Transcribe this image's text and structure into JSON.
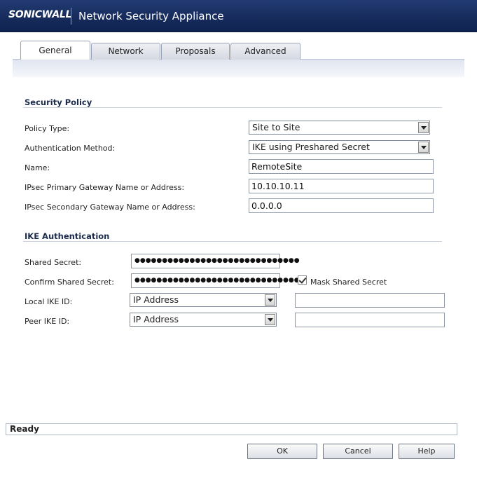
{
  "header": {
    "logo_text": "SONICWALL",
    "title": "Network Security Appliance"
  },
  "tabs": [
    {
      "label": "General",
      "active": true
    },
    {
      "label": "Network",
      "active": false
    },
    {
      "label": "Proposals",
      "active": false
    },
    {
      "label": "Advanced",
      "active": false
    }
  ],
  "security_policy": {
    "section_title": "Security Policy",
    "policy_type_label": "Policy Type:",
    "policy_type_value": "Site to Site",
    "auth_method_label": "Authentication Method:",
    "auth_method_value": "IKE using Preshared Secret",
    "name_label": "Name:",
    "name_value": "RemoteSite",
    "primary_gw_label": "IPsec Primary Gateway Name or Address:",
    "primary_gw_value": "10.10.10.11",
    "secondary_gw_label": "IPsec Secondary Gateway Name or Address:",
    "secondary_gw_value": "0.0.0.0"
  },
  "ike_auth": {
    "section_title": "IKE Authentication",
    "shared_secret_label": "Shared Secret:",
    "shared_secret_value": "●●●●●●●●●●●●●●●●●●●●●●●●●●●●●●",
    "confirm_secret_label": "Confirm Shared Secret:",
    "confirm_secret_value": "●●●●●●●●●●●●●●●●●●●●●●●●●●●●●●",
    "mask_label": "Mask Shared Secret",
    "mask_checked": true,
    "local_ike_label": "Local IKE ID:",
    "local_ike_type": "IP Address",
    "local_ike_value": "",
    "peer_ike_label": "Peer IKE ID:",
    "peer_ike_type": "IP Address",
    "peer_ike_value": ""
  },
  "status": {
    "text": "Ready"
  },
  "buttons": {
    "ok": "OK",
    "cancel": "Cancel",
    "help": "Help"
  }
}
